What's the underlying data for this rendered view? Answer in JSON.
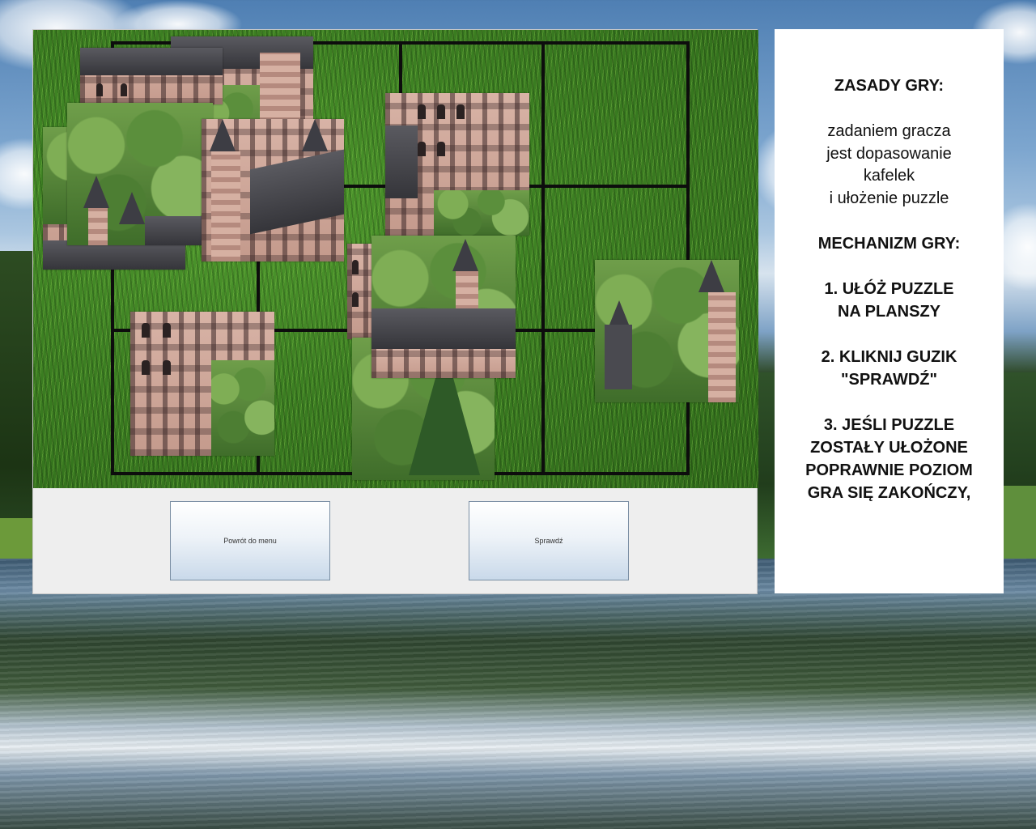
{
  "game": {
    "buttons": {
      "back_to_menu": "Powrót do menu",
      "check": "Sprawdź"
    },
    "board": {
      "grid_columns": 4,
      "grid_rows": 4,
      "tiles_visible": 9
    }
  },
  "rules": {
    "heading": "ZASADY GRY:",
    "description_lines": [
      "zadaniem gracza",
      "jest dopasowanie",
      "kafelek",
      "i ułożenie puzzle"
    ],
    "mechanics_heading": "MECHANIZM GRY:",
    "step1_lines": [
      "1. UŁÓŻ PUZZLE",
      "NA PLANSZY"
    ],
    "step2_lines": [
      "2. KLIKNIJ GUZIK",
      "\"SPRAWDŹ\""
    ],
    "step3_lines": [
      "3. JEŚLI PUZZLE",
      "ZOSTAŁY UŁOŻONE",
      "POPRAWNIE POZIOM",
      "GRA SIĘ ZAKOŃCZY,"
    ]
  },
  "colors": {
    "panel_bg": "#eeeeee",
    "rules_bg": "#ffffff",
    "grid_line": "#0d0d0d",
    "grass": "#3c7f22"
  }
}
